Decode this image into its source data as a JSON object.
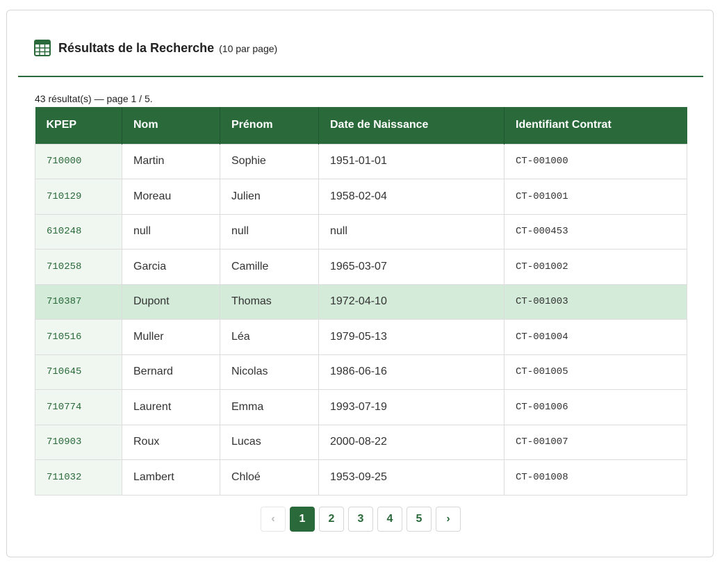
{
  "header": {
    "title": "Résultats de la Recherche",
    "subtitle": "(10 par page)",
    "icon": "table-icon"
  },
  "summary": "43 résultat(s) — page 1 / 5.",
  "table": {
    "columns": [
      "KPEP",
      "Nom",
      "Prénom",
      "Date de Naissance",
      "Identifiant Contrat"
    ],
    "rows": [
      {
        "kpep": "710000",
        "nom": "Martin",
        "prenom": "Sophie",
        "naissance": "1951-01-01",
        "contrat": "CT-001000"
      },
      {
        "kpep": "710129",
        "nom": "Moreau",
        "prenom": "Julien",
        "naissance": "1958-02-04",
        "contrat": "CT-001001"
      },
      {
        "kpep": "610248",
        "nom": "null",
        "prenom": "null",
        "naissance": "null",
        "contrat": "CT-000453"
      },
      {
        "kpep": "710258",
        "nom": "Garcia",
        "prenom": "Camille",
        "naissance": "1965-03-07",
        "contrat": "CT-001002"
      },
      {
        "kpep": "710387",
        "nom": "Dupont",
        "prenom": "Thomas",
        "naissance": "1972-04-10",
        "contrat": "CT-001003"
      },
      {
        "kpep": "710516",
        "nom": "Muller",
        "prenom": "Léa",
        "naissance": "1979-05-13",
        "contrat": "CT-001004"
      },
      {
        "kpep": "710645",
        "nom": "Bernard",
        "prenom": "Nicolas",
        "naissance": "1986-06-16",
        "contrat": "CT-001005"
      },
      {
        "kpep": "710774",
        "nom": "Laurent",
        "prenom": "Emma",
        "naissance": "1993-07-19",
        "contrat": "CT-001006"
      },
      {
        "kpep": "710903",
        "nom": "Roux",
        "prenom": "Lucas",
        "naissance": "2000-08-22",
        "contrat": "CT-001007"
      },
      {
        "kpep": "711032",
        "nom": "Lambert",
        "prenom": "Chloé",
        "naissance": "1953-09-25",
        "contrat": "CT-001008"
      }
    ],
    "selected_index": 4
  },
  "pagination": {
    "prev": "‹",
    "next": "›",
    "pages": [
      "1",
      "2",
      "3",
      "4",
      "5"
    ],
    "current": "1"
  },
  "colors": {
    "accent": "#2a6a3a",
    "selected_row": "#d3ebd8",
    "kpep_bg": "#f0f7f1"
  }
}
